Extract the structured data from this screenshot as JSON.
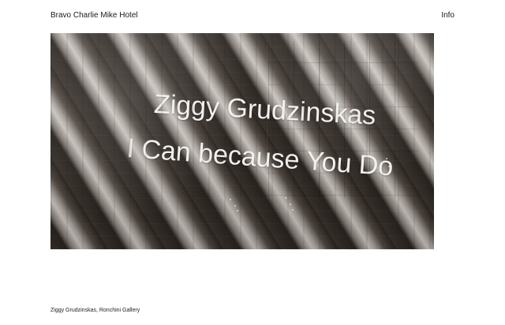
{
  "header": {
    "site_title": "Bravo Charlie Mike Hotel",
    "info_label": "Info"
  },
  "hero": {
    "line1": "Ziggy Grudzinskas",
    "line2": "I Can because You Do"
  },
  "caption": {
    "text": "Ziggy Grudzinskas, Ronchini Gallery"
  }
}
